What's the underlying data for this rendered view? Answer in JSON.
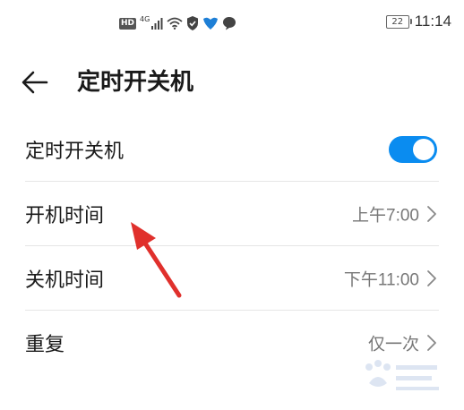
{
  "status_bar": {
    "hd": "HD",
    "network": "4G",
    "battery": "22",
    "time": "11:14"
  },
  "header": {
    "title": "定时开关机"
  },
  "settings": {
    "scheduled_power": {
      "label": "定时开关机",
      "enabled": true
    },
    "power_on_time": {
      "label": "开机时间",
      "value": "上午7:00"
    },
    "power_off_time": {
      "label": "关机时间",
      "value": "下午11:00"
    },
    "repeat": {
      "label": "重复",
      "value": "仅一次"
    }
  },
  "colors": {
    "toggle_on": "#0a8cf0",
    "annotation_arrow": "#e0302c"
  }
}
